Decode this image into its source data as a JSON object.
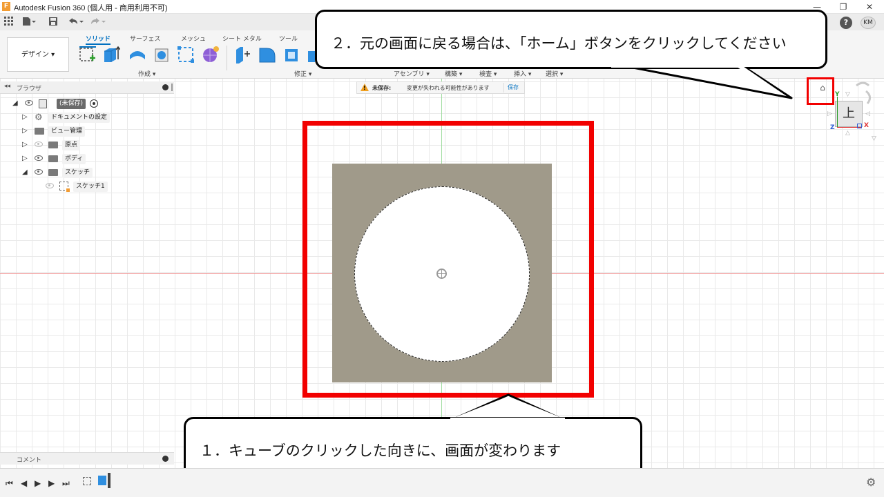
{
  "window": {
    "title": "Autodesk Fusion 360 (個人用 - 商用利用不可)",
    "app_logo_letter": "F",
    "minimize": "—",
    "restore": "❐",
    "close": "✕"
  },
  "quick_access": {
    "grid_icon": "grid-icon",
    "file_icon": "file-icon",
    "save_icon": "save-icon",
    "undo_icon": "undo-icon",
    "redo_icon": "redo-icon",
    "help_label": "?",
    "user_initials": "KM"
  },
  "toolbar": {
    "workspace_label": "デザイン ▾",
    "tabs": [
      "ソリッド",
      "サーフェス",
      "メッシュ",
      "シート メタル",
      "ツール"
    ],
    "groups": [
      "作成 ▾",
      "修正 ▾",
      "アセンブリ ▾",
      "構築 ▾",
      "検査 ▾",
      "挿入 ▾",
      "選択 ▾"
    ]
  },
  "browser": {
    "header": "ブラウザ",
    "collapse": "◂◂",
    "items": [
      {
        "label": "(未保存)"
      },
      {
        "label": "ドキュメントの設定"
      },
      {
        "label": "ビュー管理"
      },
      {
        "label": "原点"
      },
      {
        "label": "ボディ"
      },
      {
        "label": "スケッチ"
      },
      {
        "label": "スケッチ1"
      }
    ]
  },
  "warning": {
    "icon": "!",
    "title": "未保存:",
    "message": "変更が失われる可能性があります",
    "save_button": "保存"
  },
  "viewcube": {
    "face_label": "上",
    "axis_x": "X",
    "axis_y": "Y",
    "axis_z": "Z",
    "home_icon": "⌂"
  },
  "callouts": {
    "top": "２．元の画面に戻る場合は、「ホーム」ボタンをクリックしてください",
    "bottom": "１．キューブのクリックした向きに、画面が変わります"
  },
  "comment_bar": {
    "label": "コメント"
  },
  "timeline": {
    "first": "⏮",
    "prev": "◀",
    "play": "▶",
    "next": "▶",
    "last": "⏭",
    "settings_icon": "⚙"
  },
  "colors": {
    "accent": "#0070c0",
    "highlight_frame": "#f20000",
    "sketch_fill": "#a09a8a",
    "x_axis": "#f19a9a",
    "y_axis": "#9fdc9f"
  }
}
